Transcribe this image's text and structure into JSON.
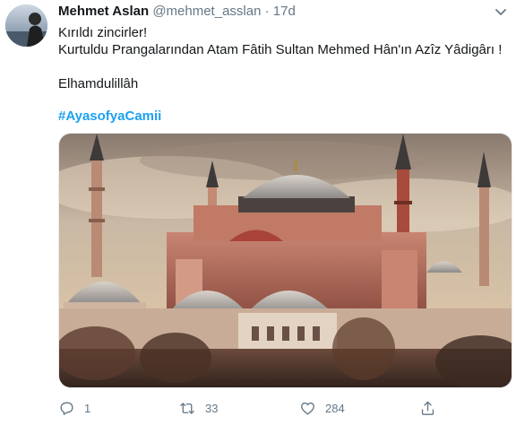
{
  "author": {
    "name": "Mehmet Aslan",
    "handle": "@mehmet_asslan",
    "separator": "·",
    "time": "17d"
  },
  "tweet": {
    "lines": [
      "Kırıldı zincirler!",
      "Kurtuldu Prangalarından Atam Fâtih Sultan Mehmed Hân'ın Azîz Yâdigârı !",
      "",
      "Elhamdulillâh"
    ],
    "hashtag": "#AyasofyaCamii"
  },
  "media": {
    "subject": "Hagia Sophia mosque photo"
  },
  "actions": {
    "reply_count": "1",
    "retweet_count": "33",
    "like_count": "284"
  },
  "colors": {
    "accent": "#1da1f2",
    "muted": "#657786",
    "text": "#14171a"
  },
  "icons": [
    "chevron-down-icon",
    "reply-icon",
    "retweet-icon",
    "like-icon",
    "share-icon"
  ]
}
